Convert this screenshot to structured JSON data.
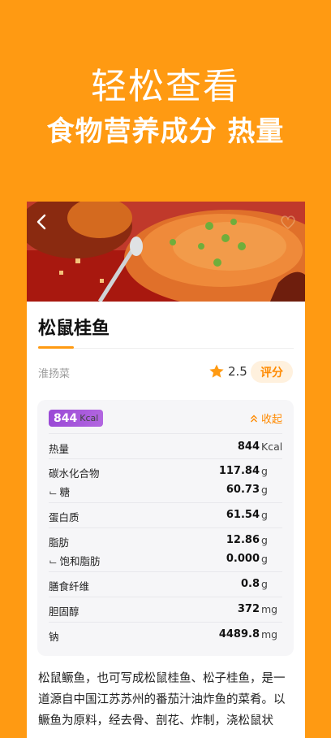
{
  "promo": {
    "line1": "轻松查看",
    "line2": "食物营养成分 热量"
  },
  "dish": {
    "name": "松鼠桂鱼",
    "cuisine": "淮扬菜",
    "rating": "2.5",
    "rate_label": "评分"
  },
  "nutrition": {
    "kcal_value": "844",
    "kcal_unit": "Kcal",
    "collapse_label": "收起",
    "rows": [
      {
        "label": "热量",
        "value": "844",
        "unit": "Kcal"
      },
      {
        "label": "碳水化合物",
        "value": "117.84",
        "unit": "g"
      },
      {
        "label": "糖",
        "value": "60.73",
        "unit": "g"
      },
      {
        "label": "蛋白质",
        "value": "61.54",
        "unit": "g"
      },
      {
        "label": "脂肪",
        "value": "12.86",
        "unit": "g"
      },
      {
        "label": "饱和脂肪",
        "value": "0.000",
        "unit": "g"
      },
      {
        "label": "膳食纤维",
        "value": "0.8",
        "unit": "g"
      },
      {
        "label": "胆固醇",
        "value": "372",
        "unit": "mg"
      },
      {
        "label": "钠",
        "value": "4489.8",
        "unit": "mg"
      }
    ]
  },
  "description": "松鼠鳜鱼，也可写成松鼠桂鱼、松子桂鱼，是一道源自中国江苏苏州的番茄汁油炸鱼的菜肴。以鳜鱼为原料，经去骨、剖花、炸制，浇松鼠状",
  "colors": {
    "brand": "#FF9A12",
    "accent": "#FF8A00",
    "kcal_badge": "#A452DA"
  }
}
